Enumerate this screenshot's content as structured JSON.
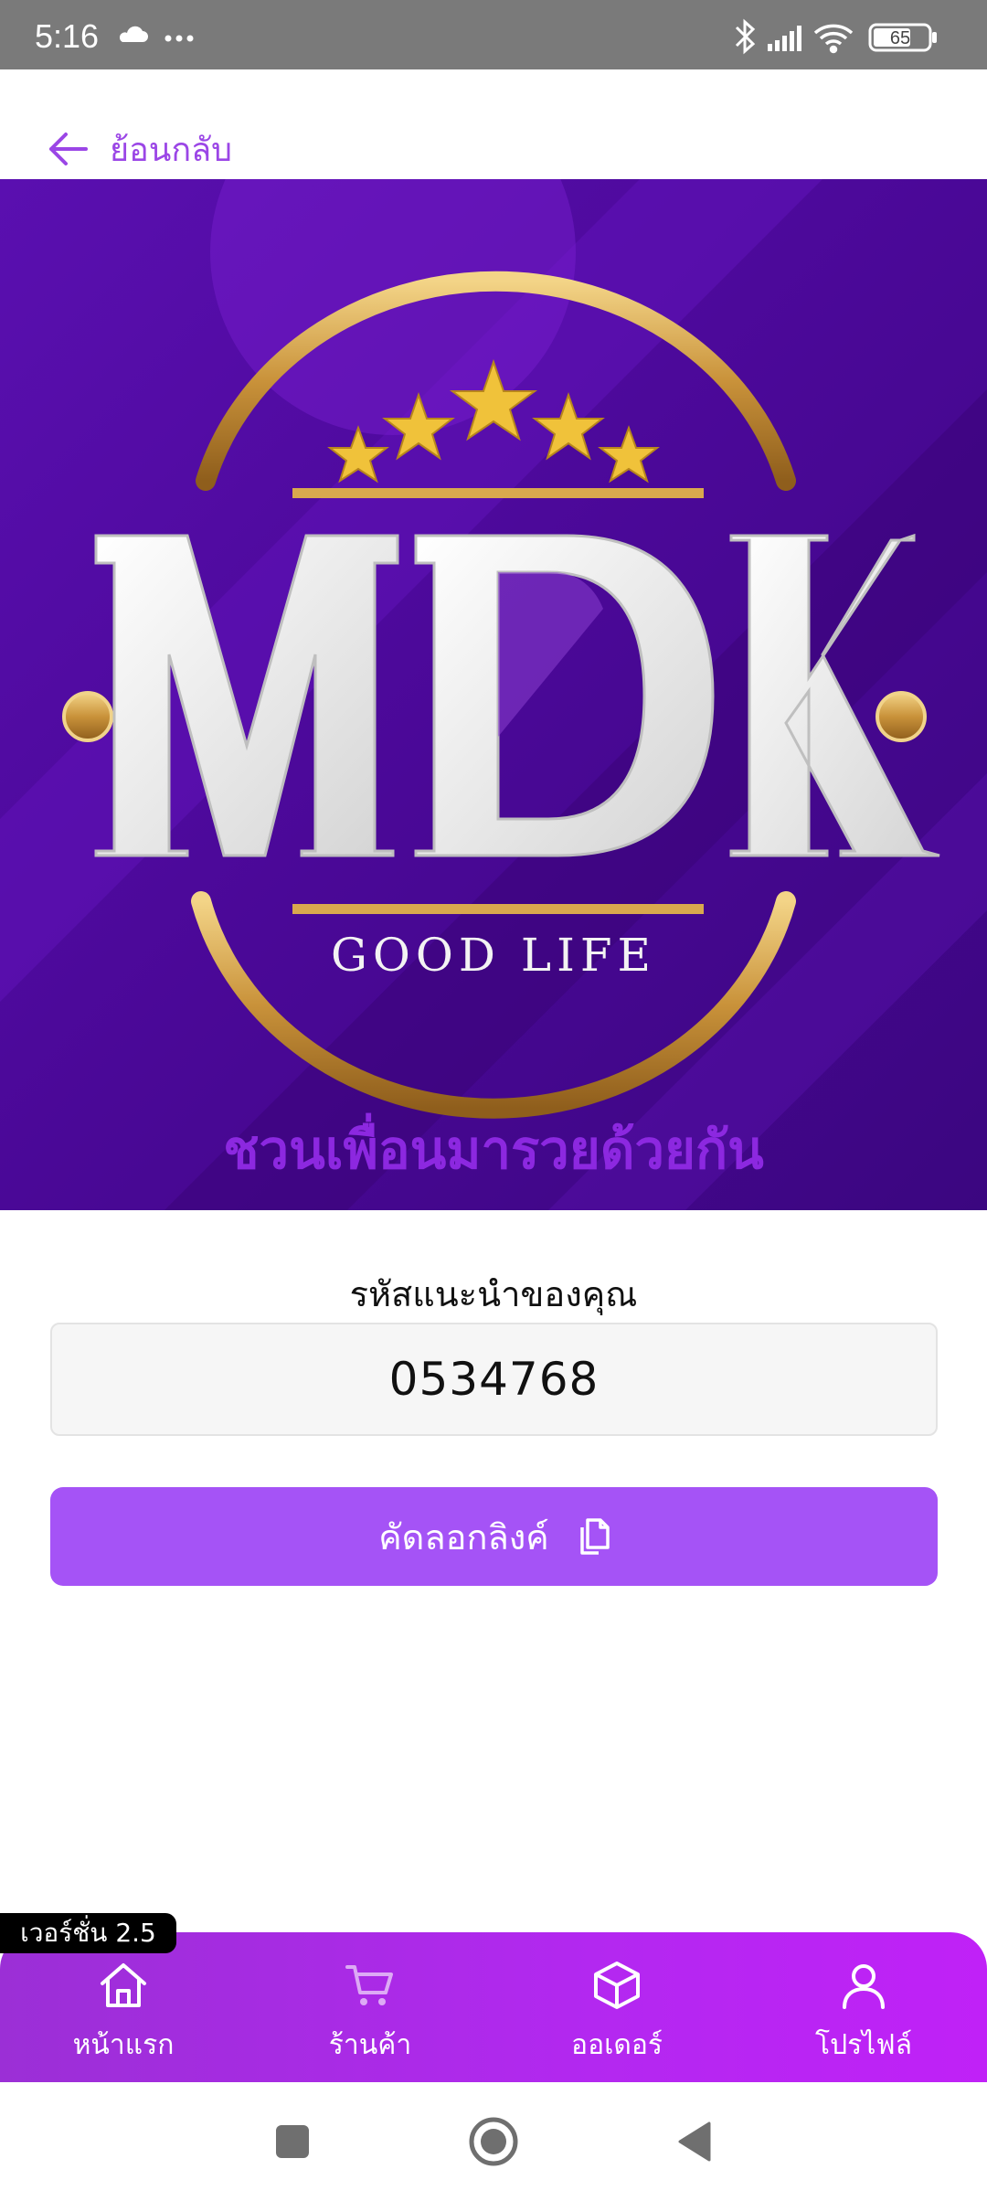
{
  "status": {
    "time": "5:16",
    "battery": "65",
    "icons": [
      "cloud-icon",
      "more-dots-icon",
      "bluetooth-icon",
      "signal-icon",
      "wifi-icon",
      "battery-icon"
    ]
  },
  "header": {
    "back_label": "ย้อนกลับ",
    "back_icon": "arrow-left-icon"
  },
  "banner": {
    "brand": "MDK",
    "tagline": "GOOD LIFE",
    "headline": "ชวนเพื่อนมารวยด้วยกัน",
    "colors": {
      "bg": "#4b0a96",
      "gold": "#d9a94e",
      "headline": "#8c28e0"
    }
  },
  "referral": {
    "title": "รหัสแนะนำของคุณ",
    "code": "0534768"
  },
  "copy_button": {
    "label": "คัดลอกลิงค์",
    "icon": "copy-icon",
    "color": "#a553f6"
  },
  "version": "เวอร์ชั่น 2.5",
  "nav": [
    {
      "label": "หน้าแรก",
      "icon": "home-icon"
    },
    {
      "label": "ร้านค้า",
      "icon": "cart-icon"
    },
    {
      "label": "ออเดอร์",
      "icon": "box-icon"
    },
    {
      "label": "โปรไฟล์",
      "icon": "user-icon"
    }
  ]
}
